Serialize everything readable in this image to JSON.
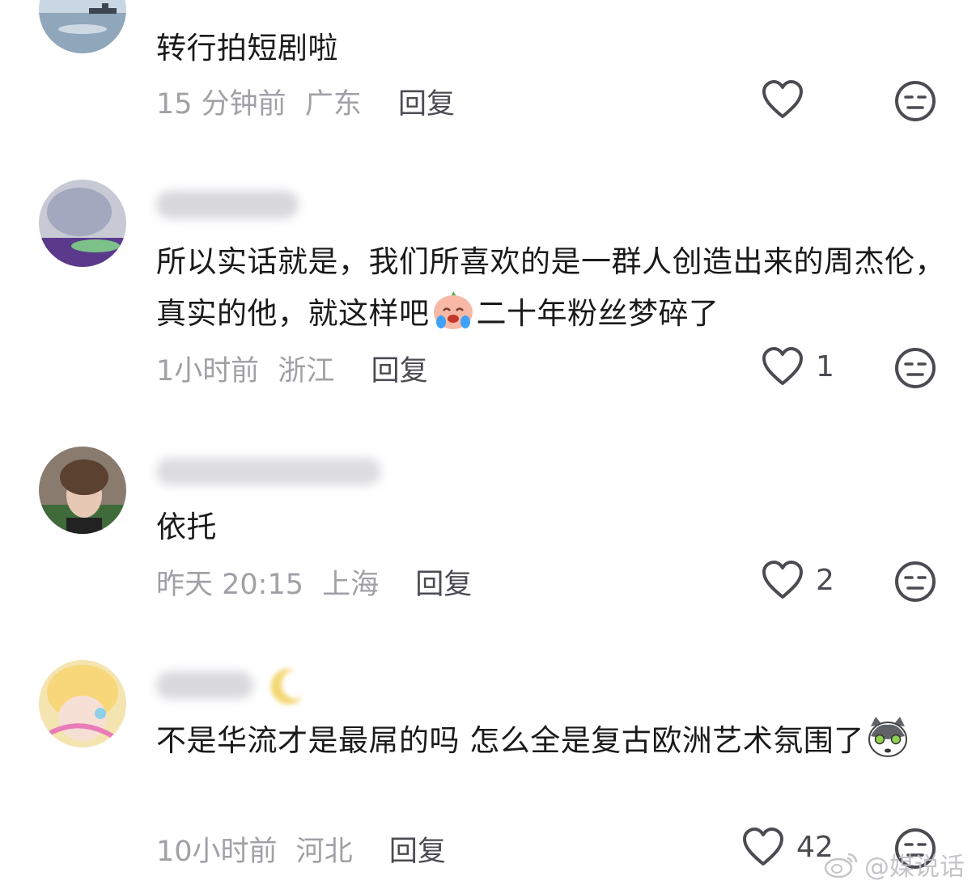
{
  "comments": [
    {
      "username": "",
      "text": "转行拍短剧啦",
      "time": "15 分钟前",
      "location": "广东",
      "reply_label": "回复",
      "likes": ""
    },
    {
      "username": "",
      "text": "所以实话就是，我们所喜欢的是一群人创造出来的周杰伦，真实的他，就这样吧",
      "text_after_emoji": "二十年粉丝梦碎了",
      "emoji": "crying-face",
      "time": "1小时前",
      "location": "浙江",
      "reply_label": "回复",
      "likes": "1"
    },
    {
      "username": "",
      "text": "依托",
      "time": "昨天 20:15",
      "location": "上海",
      "reply_label": "回复",
      "likes": "2"
    },
    {
      "username": "",
      "text": "不是华流才是最屌的吗 怎么全是复古欧洲艺术氛围了",
      "emoji": "cat-face",
      "time": "10小时前",
      "location": "河北",
      "reply_label": "回复",
      "likes": "42"
    }
  ],
  "watermark": {
    "text": "@媒说话",
    "icon": "weibo-icon"
  },
  "colors": {
    "meta": "#a0a0a6",
    "text": "#1a1a1a",
    "reply": "#4b4b52"
  }
}
